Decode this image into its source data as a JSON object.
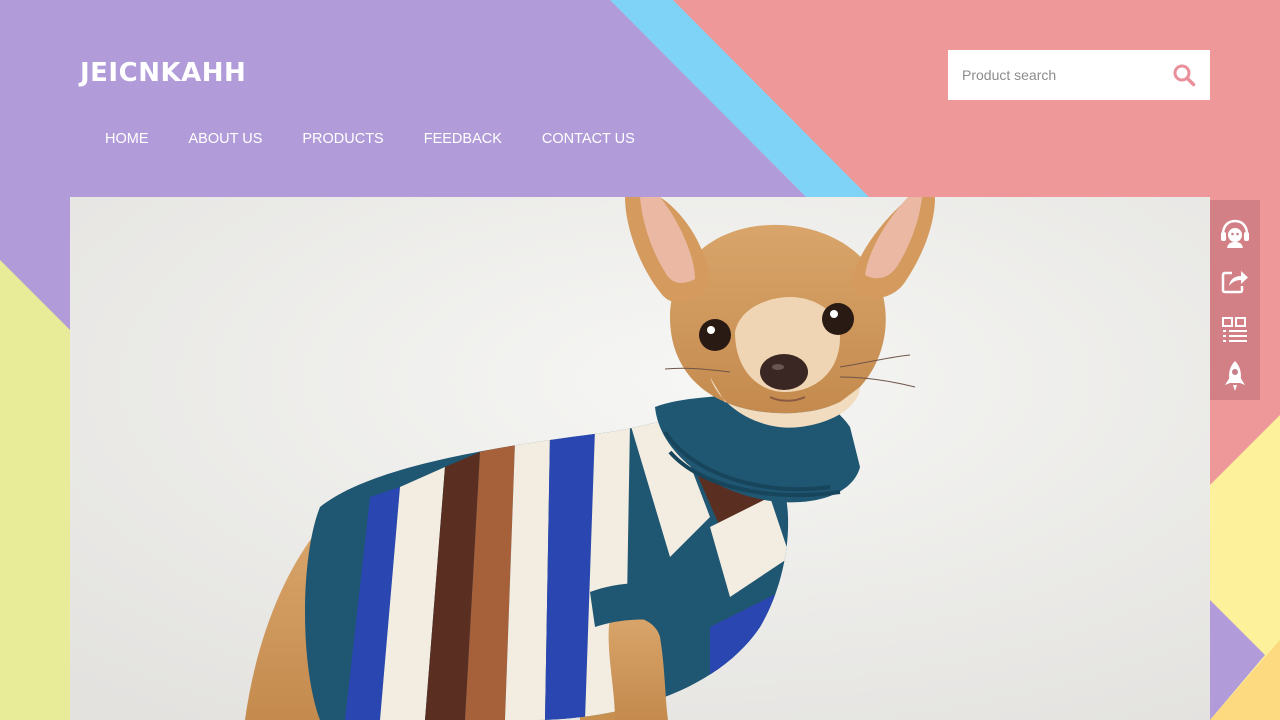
{
  "brand": {
    "name": "JEICNKAHH"
  },
  "nav": {
    "items": [
      {
        "label": "HOME"
      },
      {
        "label": "ABOUT US"
      },
      {
        "label": "PRODUCTS"
      },
      {
        "label": "FEEDBACK"
      },
      {
        "label": "CONTACT US"
      }
    ]
  },
  "search": {
    "placeholder": "Product search",
    "value": "",
    "icon": "search-icon"
  },
  "hero": {
    "image": "chihuahua-in-striped-sweater-photo"
  },
  "side_toolbar": {
    "icons": [
      "customer-service-icon",
      "share-icon",
      "qr-code-icon",
      "rocket-back-to-top-icon"
    ]
  },
  "colors": {
    "purple": "#b19cd9",
    "cyan": "#7fd3f7",
    "pink": "#ef9899",
    "yellow": "#e8ec98",
    "light_yellow": "#fdf19c",
    "orange": "#fdd97f",
    "accent": "#e9909a"
  }
}
